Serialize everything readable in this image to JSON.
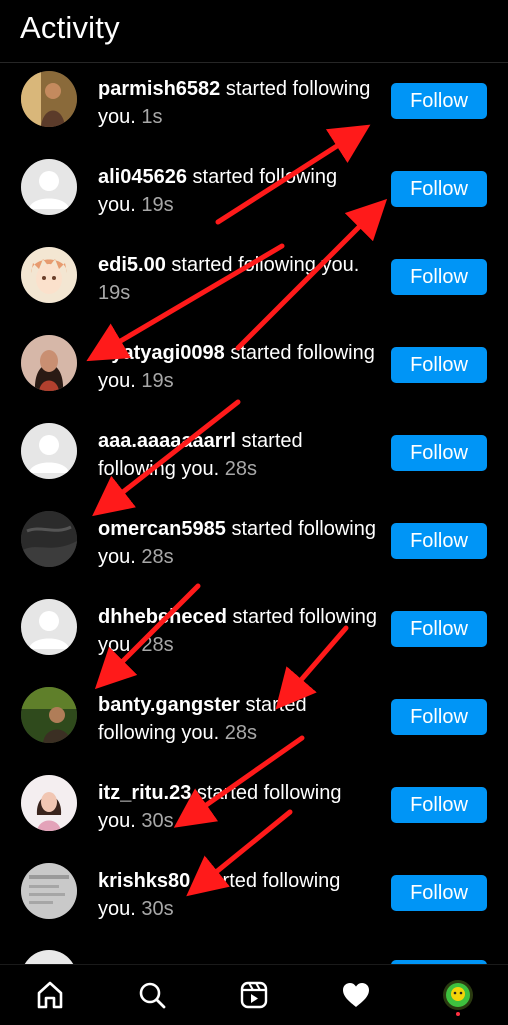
{
  "header": {
    "title": "Activity"
  },
  "notifications": [
    {
      "username": "parmish6582",
      "message": "started following you.",
      "time": "1s",
      "avatar": "photo-woman-warm",
      "button": "Follow"
    },
    {
      "username": "ali045626",
      "message": "started following you.",
      "time": "19s",
      "avatar": "default-avatar",
      "button": "Follow"
    },
    {
      "username": "edi5.00",
      "message": "started following you.",
      "time": "19s",
      "avatar": "anime-character",
      "button": "Follow"
    },
    {
      "username": "riyatyagi0098",
      "message": "started following you.",
      "time": "19s",
      "avatar": "photo-woman",
      "button": "Follow"
    },
    {
      "username": "aaa.aaaaaaarrl",
      "message": "started following you.",
      "time": "28s",
      "avatar": "default-avatar",
      "button": "Follow"
    },
    {
      "username": "omercan5985",
      "message": "started following you.",
      "time": "28s",
      "avatar": "photo-dark",
      "button": "Follow"
    },
    {
      "username": "dhhebeheced",
      "message": "started following you.",
      "time": "28s",
      "avatar": "default-avatar",
      "button": "Follow"
    },
    {
      "username": "banty.gangster",
      "message": "started following you.",
      "time": "28s",
      "avatar": "photo-green",
      "button": "Follow"
    },
    {
      "username": "itz_ritu.23",
      "message": "started following you.",
      "time": "30s",
      "avatar": "photo-girl",
      "button": "Follow"
    },
    {
      "username": "krishks80",
      "message": "started following you.",
      "time": "30s",
      "avatar": "photo-screenshot",
      "button": "Follow"
    }
  ],
  "bottom_nav": [
    {
      "icon": "home-icon"
    },
    {
      "icon": "search-icon"
    },
    {
      "icon": "reels-icon"
    },
    {
      "icon": "heart-icon"
    },
    {
      "icon": "profile-avatar"
    }
  ],
  "colors": {
    "background": "#000000",
    "follow_button": "#0095f6",
    "timestamp": "#a8a8a8",
    "annotation_arrow": "#ff0000"
  }
}
